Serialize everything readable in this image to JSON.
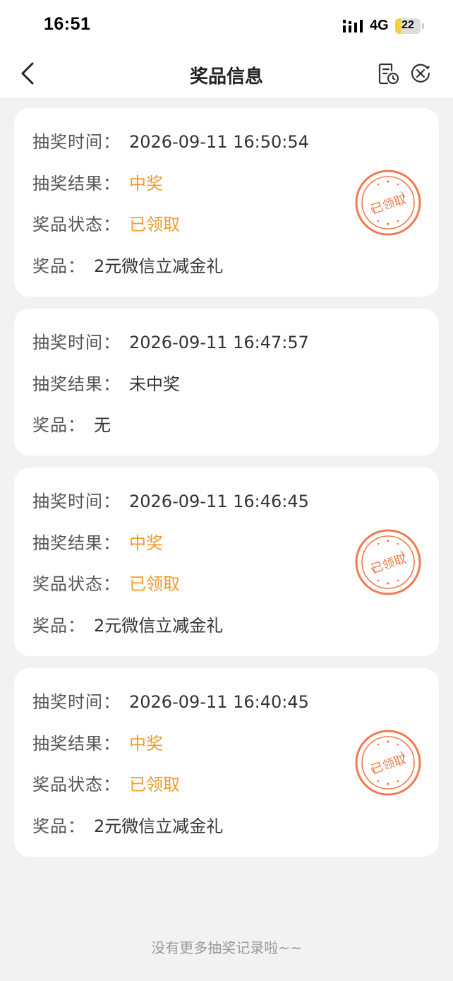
{
  "status_bar": {
    "time": "16:51",
    "network": "4G",
    "battery": "22",
    "battery_level": 0.22
  },
  "nav": {
    "title": "奖品信息"
  },
  "labels": {
    "time": "抽奖时间：",
    "result": "抽奖结果：",
    "status": "奖品状态：",
    "prize": "奖品："
  },
  "records": [
    {
      "time": "2026-09-11 16:50:54",
      "result": "中奖",
      "status": "已领取",
      "prize": "2元微信立减金礼",
      "stamp": "已领取"
    },
    {
      "time": "2026-09-11 16:47:57",
      "result": "未中奖",
      "prize": "无"
    },
    {
      "time": "2026-09-11 16:46:45",
      "result": "中奖",
      "status": "已领取",
      "prize": "2元微信立减金礼",
      "stamp": "已领取"
    },
    {
      "time": "2026-09-11 16:40:45",
      "result": "中奖",
      "status": "已领取",
      "prize": "2元微信立减金礼",
      "stamp": "已领取"
    }
  ],
  "footer": "没有更多抽奖记录啦~~",
  "colors": {
    "accent": "#f39a2b",
    "stamp": "#f07a4e",
    "background": "#f2f2f2"
  }
}
